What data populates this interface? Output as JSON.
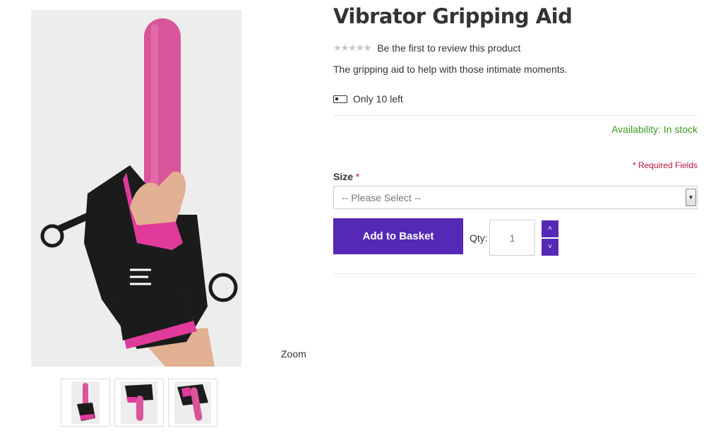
{
  "gallery": {
    "zoom_label": "Zoom",
    "thumbnails": [
      "thumbnail-1",
      "thumbnail-2",
      "thumbnail-3"
    ]
  },
  "product": {
    "title": "Vibrator Gripping Aid",
    "rating_stars": "★★★★★",
    "review_link": "Be the first to review this product",
    "short_description": "The gripping aid to help with those intimate moments.",
    "stock_left": "Only 10 left",
    "availability": "Availability: In stock"
  },
  "form": {
    "required_note": "* Required Fields",
    "size_label": "Size",
    "required_star": "*",
    "size_placeholder": "-- Please Select --",
    "add_button": "Add to Basket",
    "qty_label": "Qty:",
    "qty_value": "1"
  },
  "icons": {
    "qty_up": "chevron-up-icon",
    "qty_down": "chevron-down-icon",
    "stock": "battery-low-icon",
    "select_arrow": "caret-down-icon"
  },
  "colors": {
    "accent": "#5528b5",
    "availability": "#3a9a1f",
    "required": "#c0143c"
  }
}
